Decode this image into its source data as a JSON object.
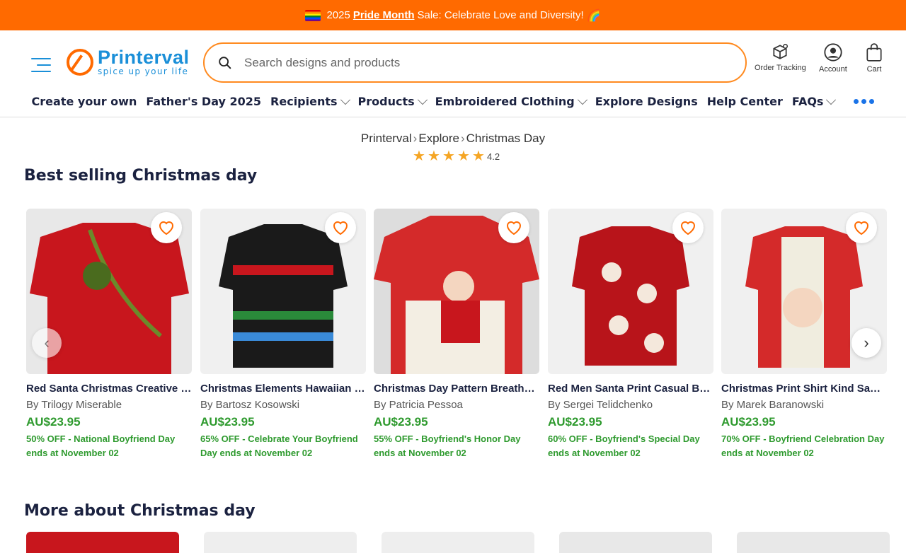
{
  "promo": {
    "pre": "2025",
    "link": "Pride Month",
    "post": "Sale: Celebrate Love and Diversity!"
  },
  "logo": {
    "name": "Printerval",
    "tagline": "spice up your life"
  },
  "search": {
    "placeholder": "Search designs and products"
  },
  "header_actions": {
    "order_tracking": "Order Tracking",
    "account": "Account",
    "cart": "Cart"
  },
  "nav": {
    "items": [
      {
        "label": "Create your own",
        "has_dropdown": false
      },
      {
        "label": "Father's Day 2025",
        "has_dropdown": false
      },
      {
        "label": "Recipients",
        "has_dropdown": true
      },
      {
        "label": "Products",
        "has_dropdown": true
      },
      {
        "label": "Embroidered Clothing",
        "has_dropdown": true
      },
      {
        "label": "Explore Designs",
        "has_dropdown": false
      },
      {
        "label": "Help Center",
        "has_dropdown": false
      },
      {
        "label": "FAQs",
        "has_dropdown": true
      }
    ]
  },
  "breadcrumb": {
    "items": [
      "Printerval",
      "Explore",
      "Christmas Day"
    ]
  },
  "rating": {
    "value": "4.2",
    "stars": 5
  },
  "sections": {
    "best_selling": "Best selling Christmas day",
    "more_about": "More about Christmas day"
  },
  "products": [
    {
      "title": "Red Santa Christmas Creative De...",
      "by": "By Trilogy Miserable",
      "price": "AU$23.95",
      "promo": "50% OFF - National Boyfriend Day ends at November 02",
      "color": "#c8161d"
    },
    {
      "title": "Christmas Elements Hawaiian M...",
      "by": "By Bartosz Kosowski",
      "price": "AU$23.95",
      "promo": "65% OFF - Celebrate Your Boyfriend Day ends at November 02",
      "color": "#1a1a1a"
    },
    {
      "title": "Christmas Day Pattern Breathabl...",
      "by": "By Patricia Pessoa",
      "price": "AU$23.95",
      "promo": "55% OFF - Boyfriend's Honor Day ends at November 02",
      "color": "#d42a2a"
    },
    {
      "title": "Red Men Santa Print Casual Brea...",
      "by": "By Sergei Telidchenko",
      "price": "AU$23.95",
      "promo": "60% OFF - Boyfriend's Special Day ends at November 02",
      "color": "#b8141a"
    },
    {
      "title": "Christmas Print Shirt Kind Santa ...",
      "by": "By Marek Baranowski",
      "price": "AU$23.95",
      "promo": "70% OFF - Boyfriend Celebration Day ends at November 02",
      "color": "#d42a2a"
    }
  ],
  "colors": {
    "accent": "#ff6a00",
    "brand_blue": "#1a8fd8",
    "price_green": "#2e9a2e"
  }
}
